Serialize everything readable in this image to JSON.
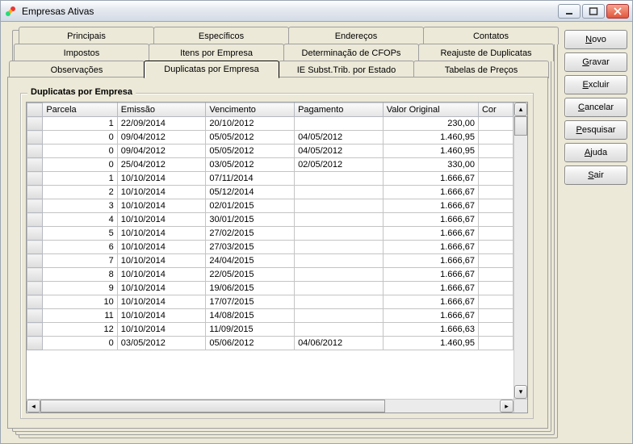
{
  "window": {
    "title": "Empresas Ativas"
  },
  "tabs": {
    "r1": [
      {
        "label": "Principais"
      },
      {
        "label": "Específicos"
      },
      {
        "label": "Endereços"
      },
      {
        "label": "Contatos"
      }
    ],
    "r2": [
      {
        "label": "Impostos"
      },
      {
        "label": "Itens por Empresa"
      },
      {
        "label": "Determinação de CFOPs"
      },
      {
        "label": "Reajuste de Duplicatas"
      }
    ],
    "r3": [
      {
        "label": "Observações"
      },
      {
        "label": "Duplicatas por Empresa"
      },
      {
        "label": "IE Subst.Trib. por Estado"
      },
      {
        "label": "Tabelas de Preços"
      }
    ]
  },
  "group": {
    "title": "Duplicatas por Empresa"
  },
  "grid": {
    "columns": [
      "Parcela",
      "Emissão",
      "Vencimento",
      "Pagamento",
      "Valor Original",
      "Cor"
    ],
    "rows": [
      {
        "parcela": "1",
        "emissao": "22/09/2014",
        "vencimento": "20/10/2012",
        "pagamento": "",
        "valor": "230,00"
      },
      {
        "parcela": "0",
        "emissao": "09/04/2012",
        "vencimento": "05/05/2012",
        "pagamento": "04/05/2012",
        "valor": "1.460,95"
      },
      {
        "parcela": "0",
        "emissao": "09/04/2012",
        "vencimento": "05/05/2012",
        "pagamento": "04/05/2012",
        "valor": "1.460,95"
      },
      {
        "parcela": "0",
        "emissao": "25/04/2012",
        "vencimento": "03/05/2012",
        "pagamento": "02/05/2012",
        "valor": "330,00"
      },
      {
        "parcela": "1",
        "emissao": "10/10/2014",
        "vencimento": "07/11/2014",
        "pagamento": "",
        "valor": "1.666,67"
      },
      {
        "parcela": "2",
        "emissao": "10/10/2014",
        "vencimento": "05/12/2014",
        "pagamento": "",
        "valor": "1.666,67"
      },
      {
        "parcela": "3",
        "emissao": "10/10/2014",
        "vencimento": "02/01/2015",
        "pagamento": "",
        "valor": "1.666,67"
      },
      {
        "parcela": "4",
        "emissao": "10/10/2014",
        "vencimento": "30/01/2015",
        "pagamento": "",
        "valor": "1.666,67"
      },
      {
        "parcela": "5",
        "emissao": "10/10/2014",
        "vencimento": "27/02/2015",
        "pagamento": "",
        "valor": "1.666,67"
      },
      {
        "parcela": "6",
        "emissao": "10/10/2014",
        "vencimento": "27/03/2015",
        "pagamento": "",
        "valor": "1.666,67"
      },
      {
        "parcela": "7",
        "emissao": "10/10/2014",
        "vencimento": "24/04/2015",
        "pagamento": "",
        "valor": "1.666,67"
      },
      {
        "parcela": "8",
        "emissao": "10/10/2014",
        "vencimento": "22/05/2015",
        "pagamento": "",
        "valor": "1.666,67"
      },
      {
        "parcela": "9",
        "emissao": "10/10/2014",
        "vencimento": "19/06/2015",
        "pagamento": "",
        "valor": "1.666,67"
      },
      {
        "parcela": "10",
        "emissao": "10/10/2014",
        "vencimento": "17/07/2015",
        "pagamento": "",
        "valor": "1.666,67"
      },
      {
        "parcela": "11",
        "emissao": "10/10/2014",
        "vencimento": "14/08/2015",
        "pagamento": "",
        "valor": "1.666,67"
      },
      {
        "parcela": "12",
        "emissao": "10/10/2014",
        "vencimento": "11/09/2015",
        "pagamento": "",
        "valor": "1.666,63"
      },
      {
        "parcela": "0",
        "emissao": "03/05/2012",
        "vencimento": "05/06/2012",
        "pagamento": "04/06/2012",
        "valor": "1.460,95"
      }
    ]
  },
  "buttons": {
    "novo": {
      "pre": "",
      "accel": "N",
      "post": "ovo"
    },
    "gravar": {
      "pre": "",
      "accel": "G",
      "post": "ravar"
    },
    "excluir": {
      "pre": "",
      "accel": "E",
      "post": "xcluir"
    },
    "cancelar": {
      "pre": "",
      "accel": "C",
      "post": "ancelar"
    },
    "pesquisar": {
      "pre": "",
      "accel": "P",
      "post": "esquisar"
    },
    "ajuda": {
      "pre": "",
      "accel": "A",
      "post": "juda"
    },
    "sair": {
      "pre": "",
      "accel": "S",
      "post": "air"
    }
  }
}
